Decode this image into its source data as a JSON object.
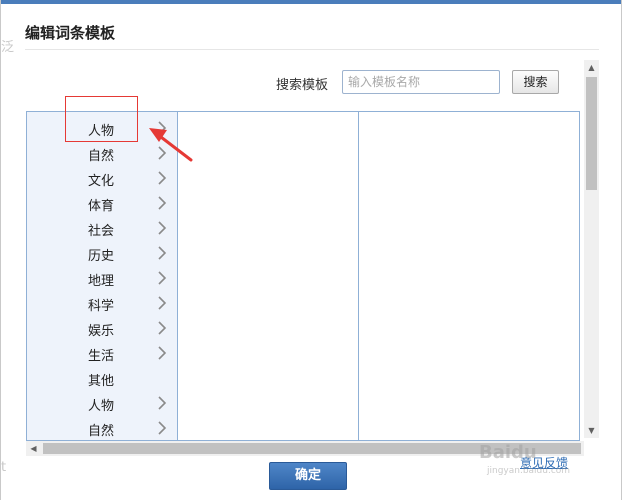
{
  "dialog": {
    "title": "编辑词条模板",
    "background_fragments": [
      "泛",
      "t"
    ]
  },
  "search": {
    "label": "搜索模板",
    "placeholder": "输入模板名称",
    "value": "",
    "button_label": "搜索"
  },
  "categories": [
    {
      "label": "人物",
      "has_children": true
    },
    {
      "label": "自然",
      "has_children": true
    },
    {
      "label": "文化",
      "has_children": true
    },
    {
      "label": "体育",
      "has_children": true
    },
    {
      "label": "社会",
      "has_children": true
    },
    {
      "label": "历史",
      "has_children": true
    },
    {
      "label": "地理",
      "has_children": true
    },
    {
      "label": "科学",
      "has_children": true
    },
    {
      "label": "娱乐",
      "has_children": true
    },
    {
      "label": "生活",
      "has_children": true
    },
    {
      "label": "其他",
      "has_children": false
    },
    {
      "label": "人物",
      "has_children": true
    },
    {
      "label": "自然",
      "has_children": true
    }
  ],
  "footer": {
    "confirm_label": "确定",
    "feedback_label": "意见反馈"
  },
  "watermark": {
    "brand": "Baidu",
    "sub": "jingyan.baidu.com"
  },
  "colors": {
    "accent": "#4a7dbb",
    "panel_border": "#8fb0d6",
    "left_column_bg": "#eef3fb",
    "annotation": "#e53935",
    "confirm_button": "#3a72b8"
  },
  "icons": {
    "category_chevron": "chevron-right-icon",
    "scroll_up": "scroll-up-arrow-icon",
    "scroll_down": "scroll-down-arrow-icon",
    "scroll_left": "scroll-left-arrow-icon",
    "scroll_right": "scroll-right-arrow-icon"
  }
}
